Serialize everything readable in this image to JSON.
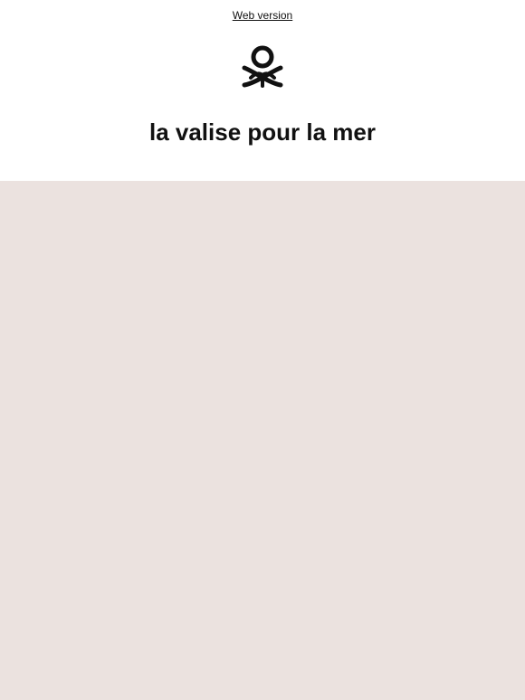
{
  "header": {
    "web_version_link": "Web version",
    "logo_icon": "knot-logo-icon",
    "title": "la valise pour la mer"
  },
  "hero": {
    "background_color": "#ebe2df"
  },
  "colors": {
    "text": "#111111",
    "background": "#ffffff"
  }
}
